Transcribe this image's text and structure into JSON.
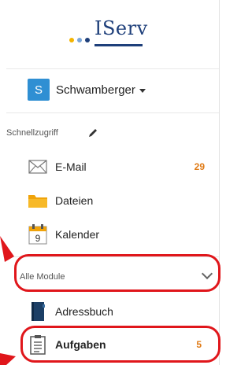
{
  "app": {
    "logo_text": "IServ",
    "dot_colors": [
      "#f4b400",
      "#7aa6d8",
      "#1e3f7a"
    ]
  },
  "user": {
    "initial": "S",
    "name": "Schwamberger"
  },
  "quick_access": {
    "label": "Schnellzugriff"
  },
  "nav": {
    "email": {
      "label": "E-Mail",
      "count": "29",
      "icon": "envelope-icon"
    },
    "files": {
      "label": "Dateien",
      "icon": "folder-icon"
    },
    "calendar": {
      "label": "Kalender",
      "day": "9",
      "icon": "calendar-icon"
    }
  },
  "modules": {
    "label": "Alle Module"
  },
  "module_items": {
    "address_book": {
      "label": "Adressbuch",
      "icon": "book-icon"
    },
    "tasks": {
      "label": "Aufgaben",
      "count": "5",
      "icon": "clipboard-icon"
    }
  },
  "colors": {
    "accent": "#2f8fd3",
    "badge": "#e07b16",
    "annotation": "#e0161b",
    "brand": "#1e3f7a"
  }
}
